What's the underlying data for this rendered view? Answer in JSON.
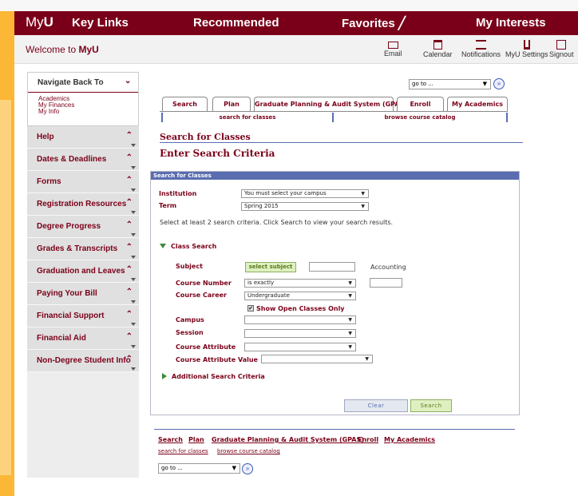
{
  "topbar": {
    "brand_prefix": "My",
    "brand_suffix": "U",
    "menu": [
      "Key Links",
      "Recommended",
      "Favorites ╱",
      "My Interests"
    ]
  },
  "welcome": {
    "prefix": "Welcome to ",
    "brand": "MyU"
  },
  "utility": [
    {
      "label": "Email",
      "icon": "envelope-icon"
    },
    {
      "label": "Calendar",
      "icon": "calendar-icon"
    },
    {
      "label": "Notifications",
      "icon": "notifications-icon"
    },
    {
      "label": "MyU Settings",
      "icon": "settings-icon"
    },
    {
      "label": "Signout",
      "icon": "signout-icon"
    }
  ],
  "sidebar": {
    "back_title": "Navigate Back To",
    "back_links": [
      "Academics",
      "My Finances",
      "My Info"
    ],
    "items": [
      "Help",
      "Dates & Deadlines",
      "Forms",
      "Registration Resources",
      "Degree Progress",
      "Grades & Transcripts",
      "Graduation and Leaves",
      "Paying Your Bill",
      "Financial Support",
      "Financial Aid",
      "Non-Degree Student Info"
    ]
  },
  "goto": {
    "value": "go to ...",
    "arrow": "▼",
    "button": "»"
  },
  "tabs": [
    "Search",
    "Plan",
    "Graduate Planning & Audit System (GPAS)",
    "Enroll",
    "My Academics"
  ],
  "subtabs": [
    "search for classes",
    "browse course catalog"
  ],
  "headings": {
    "search": "Search for Classes",
    "enter": "Enter Search Criteria",
    "panel": "Search for Classes"
  },
  "form": {
    "institution_label": "Institution",
    "institution_value": "You must select your campus",
    "term_label": "Term",
    "term_value": "Spring 2015",
    "instructions": "Select at least 2 search criteria. Click Search to view your search results.",
    "class_search_label": "Class Search",
    "subject_label": "Subject",
    "select_subject_button": "select subject",
    "subject_value": "Accounting",
    "course_number_label": "Course Number",
    "course_number_op": "is exactly",
    "course_career_label": "Course Career",
    "course_career_value": "Undergraduate",
    "open_only_label": "Show Open Classes Only",
    "open_only_check": "✔",
    "campus_label": "Campus",
    "session_label": "Session",
    "course_attribute_label": "Course Attribute",
    "course_attribute_value_label": "Course Attribute Value",
    "additional_label": "Additional Search Criteria",
    "clear_button": "Clear",
    "search_button": "Search"
  },
  "bottom_links": [
    "Search",
    "Plan",
    "Graduate Planning & Audit System (GPAS)",
    "Enroll",
    "My Academics"
  ],
  "bottom_sublinks": [
    "search for classes",
    "browse course catalog"
  ],
  "colors": {
    "maroon": "#7a0019",
    "gold": "#fbb735",
    "accent_blue": "#5a6db0",
    "green": "#8ab060"
  }
}
